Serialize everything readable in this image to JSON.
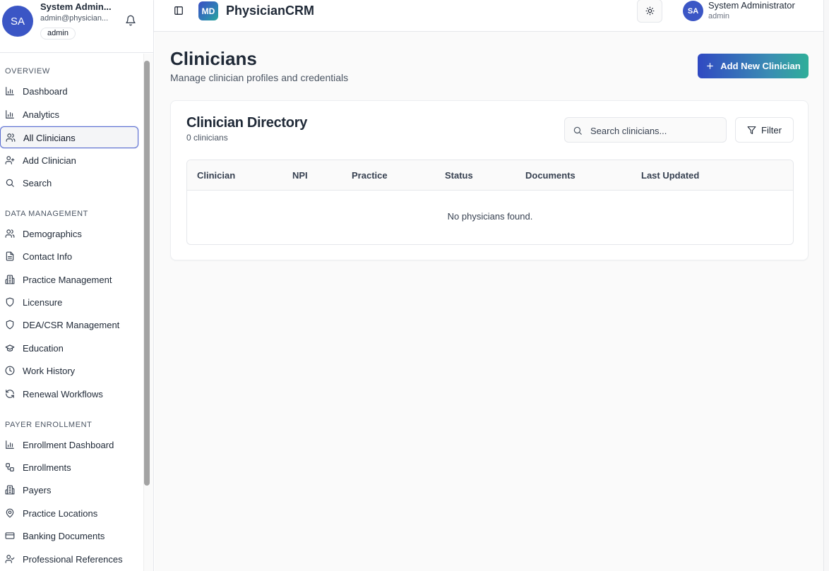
{
  "sidebar": {
    "user": {
      "initials": "SA",
      "name": "System Admin...",
      "email": "admin@physician...",
      "role": "admin"
    },
    "sections": [
      {
        "title": "OVERVIEW",
        "items": [
          {
            "label": "Dashboard",
            "icon": "bar-chart-icon"
          },
          {
            "label": "Analytics",
            "icon": "bar-chart-icon"
          },
          {
            "label": "All Clinicians",
            "icon": "users-icon",
            "active": true
          },
          {
            "label": "Add Clinician",
            "icon": "user-plus-icon"
          },
          {
            "label": "Search",
            "icon": "search-icon"
          }
        ]
      },
      {
        "title": "DATA MANAGEMENT",
        "items": [
          {
            "label": "Demographics",
            "icon": "users-icon"
          },
          {
            "label": "Contact Info",
            "icon": "file-text-icon"
          },
          {
            "label": "Practice Management",
            "icon": "building-icon"
          },
          {
            "label": "Licensure",
            "icon": "shield-icon"
          },
          {
            "label": "DEA/CSR Management",
            "icon": "shield-icon"
          },
          {
            "label": "Education",
            "icon": "graduation-cap-icon"
          },
          {
            "label": "Work History",
            "icon": "clock-icon"
          },
          {
            "label": "Renewal Workflows",
            "icon": "refresh-icon"
          }
        ]
      },
      {
        "title": "PAYER ENROLLMENT",
        "items": [
          {
            "label": "Enrollment Dashboard",
            "icon": "bar-chart-icon"
          },
          {
            "label": "Enrollments",
            "icon": "workflow-icon"
          },
          {
            "label": "Payers",
            "icon": "building-icon"
          },
          {
            "label": "Practice Locations",
            "icon": "map-pin-icon"
          },
          {
            "label": "Banking Documents",
            "icon": "credit-card-icon"
          },
          {
            "label": "Professional References",
            "icon": "user-check-icon"
          }
        ]
      }
    ]
  },
  "header": {
    "logo": "MD",
    "brand": "PhysicianCRM",
    "user": {
      "initials": "SA",
      "name": "System Administrator",
      "role": "admin"
    }
  },
  "page": {
    "title": "Clinicians",
    "subtitle": "Manage clinician profiles and credentials",
    "add_button": "Add New Clinician"
  },
  "directory": {
    "title": "Clinician Directory",
    "count": "0 clinicians",
    "search_placeholder": "Search clinicians...",
    "filter_label": "Filter",
    "columns": [
      "Clinician",
      "NPI",
      "Practice",
      "Status",
      "Documents",
      "Last Updated"
    ],
    "rows": [],
    "empty_message": "No physicians found."
  },
  "colors": {
    "accent": "#3b56c5",
    "gradient_start": "#3049c2",
    "gradient_end": "#2fae99"
  }
}
